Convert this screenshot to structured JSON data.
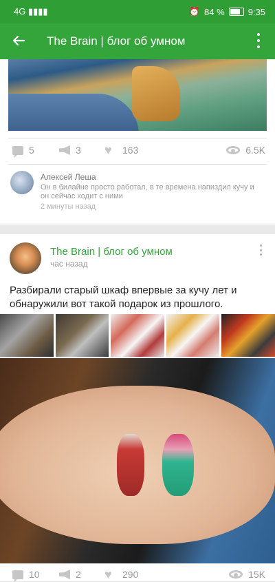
{
  "status_bar": {
    "carrier": "4G ▮▮▮▮",
    "battery": "84 %",
    "time": "9:35"
  },
  "app_bar": {
    "title": "The Brain | блог об умном",
    "back_icon": "arrow-left-icon",
    "menu_icon": "more-vertical-icon"
  },
  "post1": {
    "stats": {
      "comments": "5",
      "reposts": "3",
      "likes": "163",
      "views": "6.5K"
    },
    "comment": {
      "author": "Алексей Леша",
      "text": "Он в билайне просто работал, в те времена напиздил кучу и он сейчас ходит с ними",
      "time": "2 минуты назад"
    }
  },
  "post2": {
    "author": "The Brain | блог об умном",
    "time": "час назад",
    "text": "Разбирали старый шкаф впервые за кучу лет и обнаружили вот такой подарок из прошлого.",
    "stats": {
      "comments": "10",
      "reposts": "2",
      "likes": "290",
      "views": "15K"
    }
  },
  "colors": {
    "accent": "#33a53a",
    "status_bar": "#2e9e35",
    "muted_text": "#9a9a9a"
  }
}
